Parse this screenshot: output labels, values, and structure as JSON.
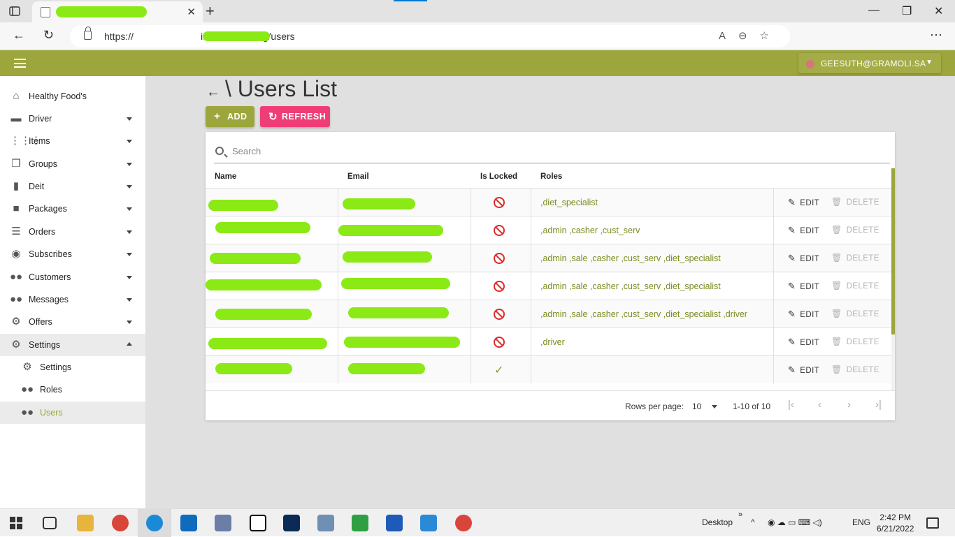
{
  "browser": {
    "url_prefix": "https://",
    "url_suffix": "i.sa/web/setting/users"
  },
  "header": {
    "user_email": "GEESUTH@GRAMOLI.SA"
  },
  "sidebar": {
    "items": [
      {
        "label": "Healthy Food's",
        "icon": "home-icon"
      },
      {
        "label": "Driver",
        "icon": "car-icon"
      },
      {
        "label": "Items",
        "icon": "grid-icon"
      },
      {
        "label": "Groups",
        "icon": "library-icon"
      },
      {
        "label": "Deit",
        "icon": "bar-chart-icon"
      },
      {
        "label": "Packages",
        "icon": "bag-icon"
      },
      {
        "label": "Orders",
        "icon": "delivery-icon"
      },
      {
        "label": "Subscribes",
        "icon": "motorbike-icon"
      },
      {
        "label": "Customers",
        "icon": "people-icon"
      },
      {
        "label": "Messages",
        "icon": "people-icon"
      },
      {
        "label": "Offers",
        "icon": "offer-icon"
      },
      {
        "label": "Settings",
        "icon": "gear-icon"
      }
    ],
    "sub_items": [
      {
        "label": "Settings",
        "icon": "gear-icon"
      },
      {
        "label": "Roles",
        "icon": "people-icon"
      },
      {
        "label": "Users",
        "icon": "people-icon"
      }
    ]
  },
  "page": {
    "title": "\\ Users List",
    "add_label": "ADD",
    "refresh_label": "REFRESH",
    "search_placeholder": "Search"
  },
  "table": {
    "columns": [
      "Name",
      "Email",
      "Is Locked",
      "Roles"
    ],
    "edit_label": "EDIT",
    "delete_label": "DELETE",
    "rows": [
      {
        "locked": true,
        "roles": ",diet_specialist"
      },
      {
        "locked": true,
        "roles": ",admin ,casher ,cust_serv"
      },
      {
        "locked": true,
        "roles": ",admin ,sale ,casher ,cust_serv ,diet_specialist"
      },
      {
        "locked": true,
        "roles": ",admin ,sale ,casher ,cust_serv ,diet_specialist"
      },
      {
        "locked": true,
        "roles": ",admin ,sale ,casher ,cust_serv ,diet_specialist ,driver"
      },
      {
        "locked": true,
        "roles": ",driver"
      },
      {
        "locked": false,
        "roles": ""
      }
    ]
  },
  "pagination": {
    "rows_per_page_label": "Rows per page:",
    "rows_per_page": "10",
    "range": "1-10 of 10"
  },
  "taskbar": {
    "desktop_label": "Desktop",
    "language": "ENG",
    "time": "2:42 PM",
    "date": "6/21/2022"
  },
  "colors": {
    "primary": "#9ca63c",
    "accent": "#ef3e77",
    "locked": "#e02828",
    "role_text": "#7d8a1f"
  }
}
